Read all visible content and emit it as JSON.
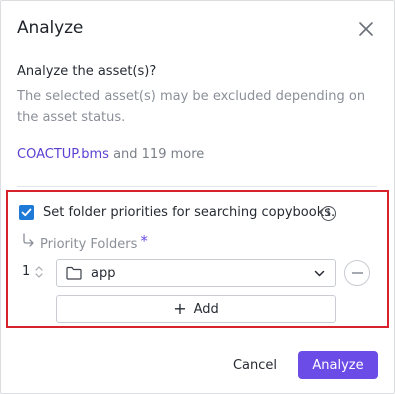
{
  "dialog": {
    "title": "Analyze",
    "question": "Analyze the asset(s)?",
    "description": "The selected asset(s) may be excluded depending on the asset status.",
    "asset_link": "COACTUP.bms",
    "asset_more": "and 119 more"
  },
  "folder_priority": {
    "checkbox_label": "Set folder priorities for searching copybooks.",
    "checked": true,
    "section_label": "Priority Folders",
    "required_mark": "*",
    "rows": [
      {
        "index": "1",
        "folder": "app"
      }
    ],
    "add_label": "Add"
  },
  "footer": {
    "cancel_label": "Cancel",
    "analyze_label": "Analyze"
  },
  "colors": {
    "primary": "#6b4ce6",
    "checkbox": "#1e7ad6",
    "highlight_border": "#d8222b",
    "link": "#5b3fd1"
  },
  "icons": {
    "close": "close-icon",
    "check": "checkmark-icon",
    "info": "info-icon",
    "indent": "indent-arrow-icon",
    "stepper": "stepper-icon",
    "folder": "folder-icon",
    "chevron": "chevron-down-icon",
    "remove": "remove-icon",
    "add": "plus-icon"
  }
}
